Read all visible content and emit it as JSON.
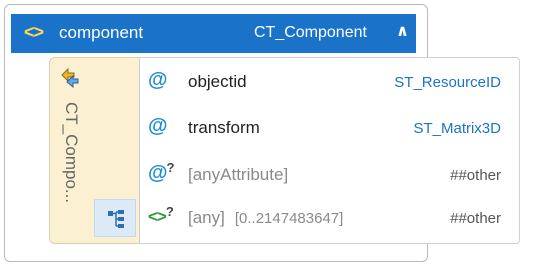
{
  "element": {
    "chevron_icon": "chevrons-icon",
    "name": "component",
    "type": "CT_Component",
    "collapse_icon": "double-chevron-up-icon",
    "collapse_glyph": "˄˄"
  },
  "complex_type": {
    "icon": "complex-type-icon",
    "label": "CT_Compo...",
    "sequence_icon": "sequence-icon"
  },
  "rows": [
    {
      "icon": "@",
      "name": "objectid",
      "type": "ST_ResourceID"
    },
    {
      "icon": "@",
      "name": "transform",
      "type": "ST_Matrix3D"
    },
    {
      "icon": "@?",
      "name": "[anyAttribute]",
      "type": "##other"
    },
    {
      "icon": "<>?",
      "name": "[any]",
      "range": "[0..2147483647]",
      "type": "##other"
    }
  ],
  "colors": {
    "header_bg": "#1a73c9",
    "panel_bg": "#fbf1d2",
    "attr_icon": "#1d8fd6",
    "type_text": "#1d73c9",
    "any_icon": "#2e9a38"
  }
}
